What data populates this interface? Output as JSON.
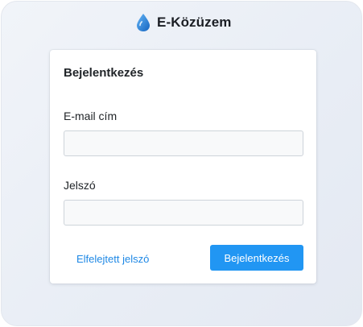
{
  "brand": {
    "name": "E-Közüzem",
    "icon": "water-drop-icon",
    "icon_colors": [
      "#1e88e5",
      "#90caf9"
    ]
  },
  "login_form": {
    "title": "Bejelentkezés",
    "email_label": "E-mail cím",
    "email_value": "",
    "email_placeholder": "",
    "password_label": "Jelszó",
    "password_value": "",
    "password_placeholder": "",
    "forgot_link": "Elfelejtett jelszó",
    "submit_label": "Bejelentkezés"
  },
  "colors": {
    "accent": "#2196f3",
    "link": "#1e88e5",
    "background": "#eef1f6",
    "card": "#ffffff"
  }
}
